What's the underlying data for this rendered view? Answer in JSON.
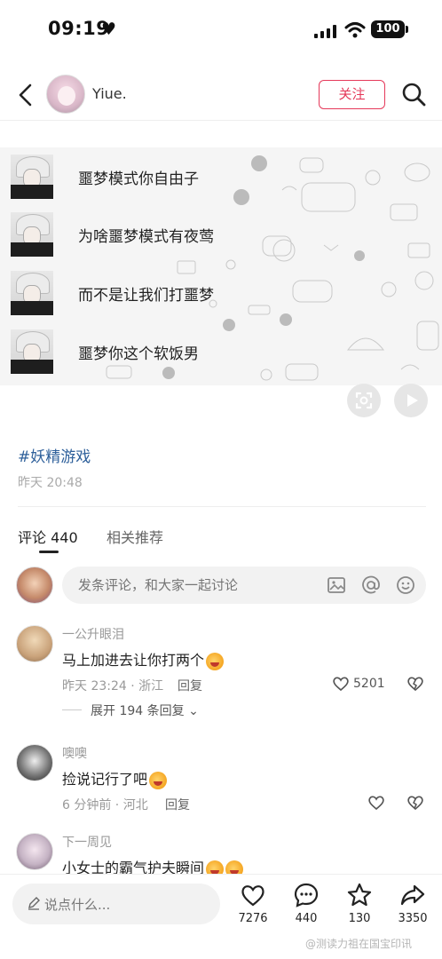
{
  "status_bar": {
    "time": "09:19",
    "battery": "100"
  },
  "header": {
    "username": "Yiue.",
    "follow_label": "关注"
  },
  "post_image": {
    "chat_lines": [
      "噩梦模式你自由子",
      "为啥噩梦模式有夜莺",
      "而不是让我们打噩梦",
      "噩梦你这个软饭男"
    ]
  },
  "post": {
    "tag": "#妖精游戏",
    "time": "昨天 20:48"
  },
  "tabs": {
    "comments": "评论 440",
    "related": "相关推荐"
  },
  "comment_input": {
    "placeholder": "发条评论，和大家一起讨论"
  },
  "comments": [
    {
      "name": "一公升眼泪",
      "text": "马上加进去让你打两个",
      "meta": "昨天 23:24 · 浙江",
      "reply": "回复",
      "likes": "5201"
    },
    {
      "name": "噢噢",
      "text": "捡说记行了吧",
      "meta": "6 分钟前 · 河北",
      "reply": "回复",
      "likes": ""
    },
    {
      "name": "下一周见",
      "text": "小女士的霸气护夫瞬间",
      "meta": "",
      "reply": "",
      "likes": ""
    }
  ],
  "expand_replies": "展开 194 条回复",
  "bottom_bar": {
    "input_placeholder": "说点什么...",
    "likes": "7276",
    "comments": "440",
    "favorites": "130",
    "shares": "3350"
  },
  "watermark": "@测读力祖在国宝印讯",
  "colors": {
    "accent": "#e5395a",
    "tag": "#2d5f9a"
  }
}
